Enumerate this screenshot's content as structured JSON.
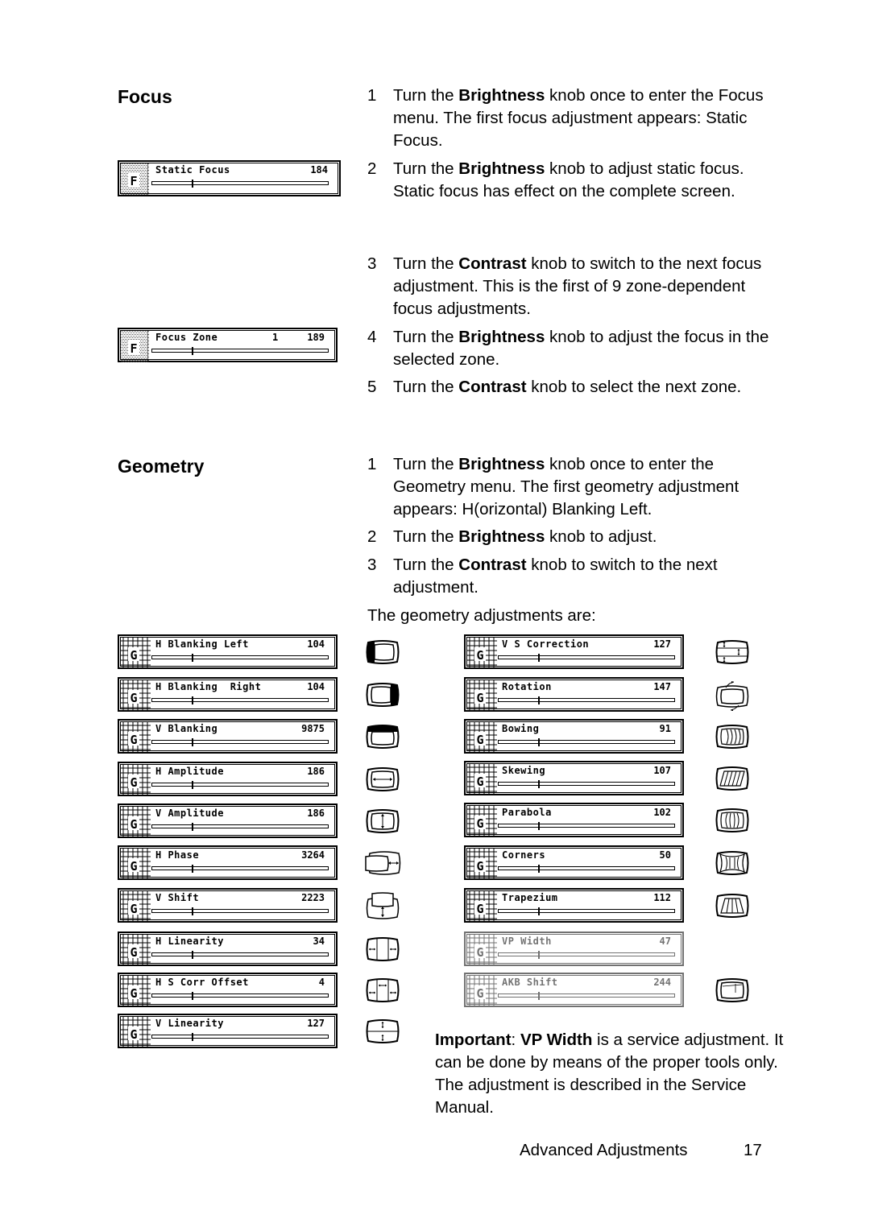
{
  "focus": {
    "heading": "Focus",
    "steps": [
      {
        "num": "1",
        "pre": "Turn the ",
        "bold": "Brightness",
        "post": " knob once to enter the Focus menu. The first focus adjustment appears: Static Focus."
      },
      {
        "num": "2",
        "pre": "Turn the ",
        "bold": "Brightness",
        "post": " knob to adjust static focus.",
        "note": "Static focus has effect on the complete screen."
      },
      {
        "num": "3",
        "pre": "Turn the ",
        "bold": "Contrast",
        "post": " knob to switch to the next focus adjustment. This is the first of 9 zone-dependent focus adjustments."
      },
      {
        "num": "4",
        "pre": "Turn the ",
        "bold": "Brightness",
        "post": " knob to adjust the focus in the selected zone."
      },
      {
        "num": "5",
        "pre": "Turn the ",
        "bold": "Contrast",
        "post": " knob to select the next zone."
      }
    ],
    "osd": [
      {
        "menu_letter": "F",
        "label": "Static Focus",
        "value": "184",
        "level_pct": 23
      },
      {
        "menu_letter": "F",
        "label": "Focus Zone",
        "zone": "1",
        "value": "189",
        "level_pct": 23
      }
    ]
  },
  "geometry": {
    "heading": "Geometry",
    "steps": [
      {
        "num": "1",
        "pre": "Turn the ",
        "bold": "Brightness",
        "post": " knob once to enter the Geometry menu. The first geometry adjustment appears: H(orizontal) Blanking Left."
      },
      {
        "num": "2",
        "pre": "Turn the ",
        "bold": "Brightness",
        "post": " knob to adjust."
      },
      {
        "num": "3",
        "pre": "Turn the ",
        "bold": "Contrast",
        "post": " knob to switch to the next adjustment."
      }
    ],
    "intro": "The geometry adjustments are:",
    "left_column": [
      {
        "menu_letter": "G",
        "label": "H Blanking Left",
        "value": "104",
        "icon": "h-blanking-left-icon",
        "level_pct": 23
      },
      {
        "menu_letter": "G",
        "label": "H Blanking  Right",
        "value": "104",
        "icon": "h-blanking-right-icon",
        "level_pct": 23
      },
      {
        "menu_letter": "G",
        "label": "V Blanking",
        "value": "9875",
        "icon": "v-blanking-icon",
        "level_pct": 23
      },
      {
        "menu_letter": "G",
        "label": "H Amplitude",
        "value": "186",
        "icon": "h-amplitude-icon",
        "level_pct": 23
      },
      {
        "menu_letter": "G",
        "label": "V Amplitude",
        "value": "186",
        "icon": "v-amplitude-icon",
        "level_pct": 23
      },
      {
        "menu_letter": "G",
        "label": "H Phase",
        "value": "3264",
        "icon": "h-phase-icon",
        "level_pct": 23
      },
      {
        "menu_letter": "G",
        "label": "V Shift",
        "value": "2223",
        "icon": "v-shift-icon",
        "level_pct": 23
      },
      {
        "menu_letter": "G",
        "label": "H Linearity",
        "value": "34",
        "icon": "h-linearity-icon",
        "level_pct": 23
      },
      {
        "menu_letter": "G",
        "label": "H S Corr Offset",
        "value": "4",
        "icon": "h-s-corr-offset-icon",
        "level_pct": 23
      },
      {
        "menu_letter": "G",
        "label": "V Linearity",
        "value": "127",
        "icon": "v-linearity-icon",
        "level_pct": 23
      }
    ],
    "right_column": [
      {
        "menu_letter": "G",
        "label": "V S Correction",
        "value": "127",
        "icon": "v-s-correction-icon",
        "level_pct": 23
      },
      {
        "menu_letter": "G",
        "label": "Rotation",
        "value": "147",
        "icon": "rotation-icon",
        "level_pct": 23
      },
      {
        "menu_letter": "G",
        "label": "Bowing",
        "value": "91",
        "icon": "bowing-icon",
        "level_pct": 23
      },
      {
        "menu_letter": "G",
        "label": "Skewing",
        "value": "107",
        "icon": "skewing-icon",
        "level_pct": 23
      },
      {
        "menu_letter": "G",
        "label": "Parabola",
        "value": "102",
        "icon": "parabola-icon",
        "level_pct": 23
      },
      {
        "menu_letter": "G",
        "label": "Corners",
        "value": "50",
        "icon": "corners-icon",
        "level_pct": 23
      },
      {
        "menu_letter": "G",
        "label": "Trapezium",
        "value": "112",
        "icon": "trapezium-icon",
        "level_pct": 23
      },
      {
        "menu_letter": "G",
        "label": "VP Width",
        "value": "47",
        "icon": "",
        "level_pct": 23
      },
      {
        "menu_letter": "G",
        "label": "AKB Shift",
        "value": "244",
        "icon": "akb-shift-icon",
        "level_pct": 23
      }
    ]
  },
  "important": {
    "label": "Important",
    "sep": ": ",
    "bold2": "VP Width",
    "text": " is a service adjustment. It can be done by means of the proper tools only. The adjustment is described in the Service Manual."
  },
  "footer": {
    "section": "Advanced Adjustments",
    "page": "17"
  }
}
